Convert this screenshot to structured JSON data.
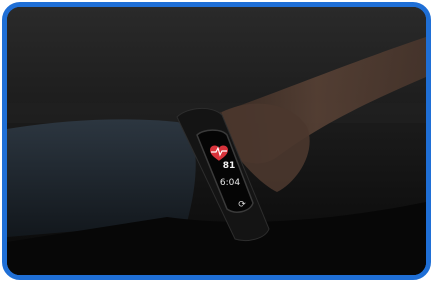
{
  "photo": {
    "description_icon": "heart-rate-icon",
    "frame_color": "#1f6fd6"
  },
  "watch_screen": {
    "heart_rate": "81",
    "time": "6:04",
    "refresh_icon": "refresh-icon"
  },
  "colors": {
    "heart": "#d8333b",
    "background": "#0d0d0d"
  }
}
